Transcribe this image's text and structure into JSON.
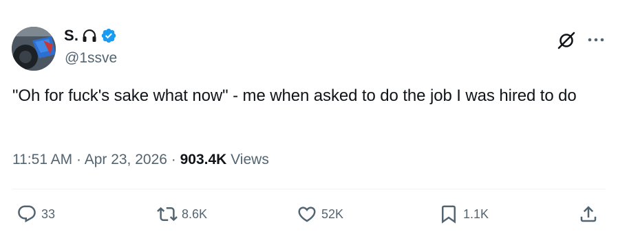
{
  "author": {
    "display_name": "S.",
    "name_emoji": "headphones-icon",
    "handle": "@1ssve",
    "verified": true
  },
  "tweet": {
    "text": "\"Oh for fuck's sake what now\" - me when asked to do the job I was hired to do"
  },
  "meta": {
    "time": "11:51 AM",
    "separator1": " · ",
    "date": "Apr 23, 2026",
    "separator2": " · ",
    "views_count": "903.4K",
    "views_label": " Views"
  },
  "actions": {
    "reply_count": "33",
    "repost_count": "8.6K",
    "like_count": "52K",
    "bookmark_count": "1.1K"
  },
  "colors": {
    "text_primary": "#0f1419",
    "text_secondary": "#536471",
    "verified_blue": "#1d9bf0",
    "divider": "#eff3f4"
  }
}
